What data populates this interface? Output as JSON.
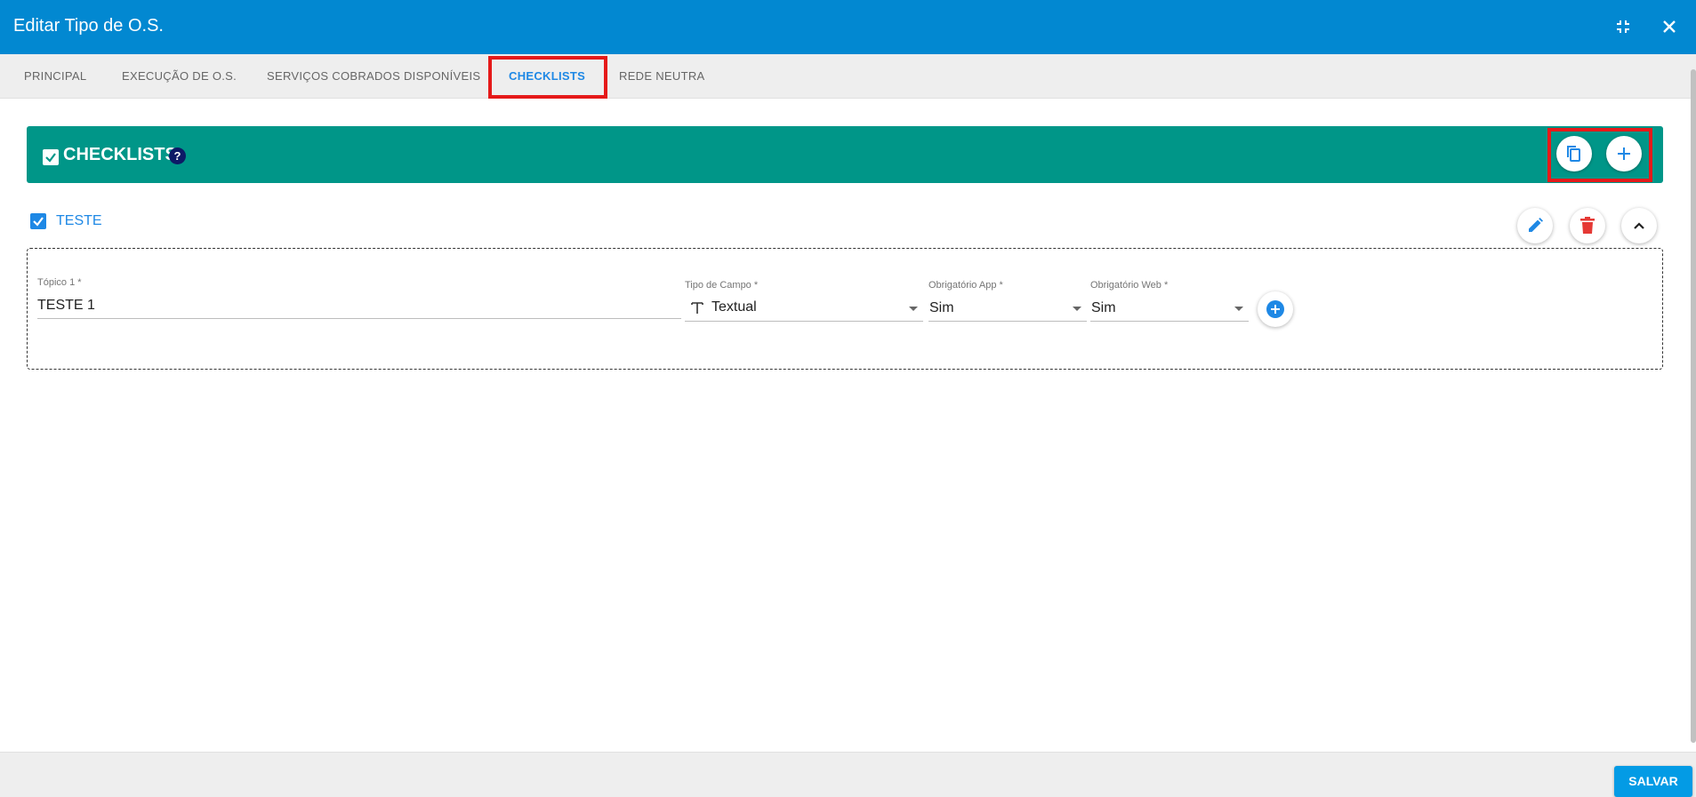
{
  "dialog": {
    "title": "Editar Tipo de O.S.",
    "icons": [
      "collapse-icon",
      "close-icon"
    ]
  },
  "tabs": [
    {
      "label": "PRINCIPAL"
    },
    {
      "label": "EXECUÇÃO DE O.S."
    },
    {
      "label": "SERVIÇOS COBRADOS DISPONÍVEIS"
    },
    {
      "label": "CHECKLISTS",
      "active": true
    },
    {
      "label": "REDE NEUTRA"
    }
  ],
  "section": {
    "title": "CHECKLISTS",
    "help": "?",
    "color": "#009688",
    "actions": [
      "copy-icon",
      "add-icon"
    ]
  },
  "checklist": {
    "title": "TESTE",
    "checked": true,
    "actions": [
      "edit-icon",
      "delete-icon",
      "collapse-up-icon"
    ],
    "topics": [
      {
        "topic_label": "Tópico 1 *",
        "topic_value": "TESTE 1",
        "type_label": "Tipo de Campo *",
        "type_value": "Textual",
        "type_icon": "text-type-icon",
        "app_label": "Obrigatório App *",
        "app_value": "Sim",
        "web_label": "Obrigatório Web *",
        "web_value": "Sim"
      }
    ]
  },
  "footer": {
    "save_label": "SALVAR"
  },
  "colors": {
    "primary": "#0288d1",
    "accent": "#1e88e5",
    "danger": "#e53935",
    "highlight": "#e51a1a"
  }
}
